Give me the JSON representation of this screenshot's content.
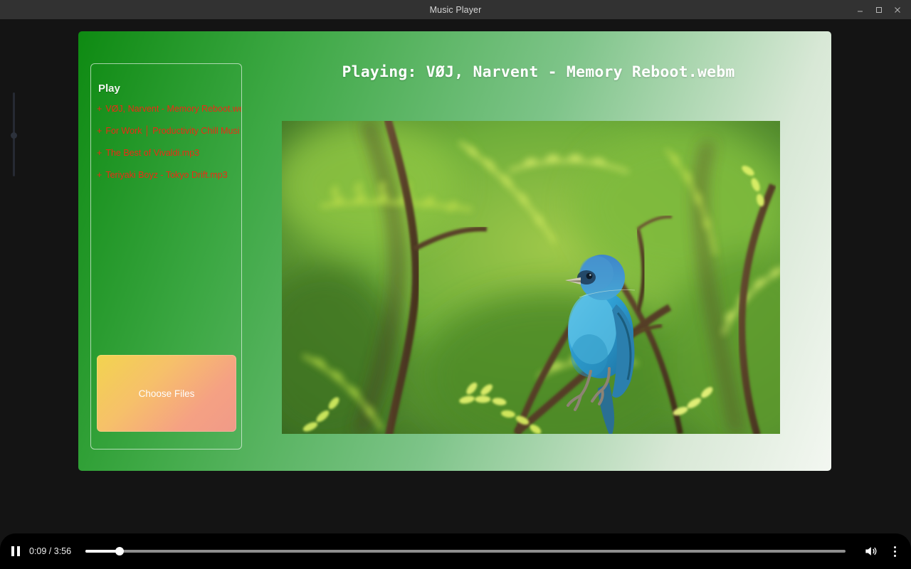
{
  "window": {
    "title": "Music Player",
    "controls": [
      {
        "name": "minimize-button",
        "glyph": "–"
      },
      {
        "name": "maximize-button",
        "glyph": "□"
      },
      {
        "name": "close-button",
        "glyph": "×"
      }
    ]
  },
  "sidebar": {
    "heading": "Play",
    "playlist": [
      {
        "bullet": "+",
        "label": "VØJ, Narvent - Memory Reboot.we"
      },
      {
        "bullet": "+",
        "label": "For Work │ Productivity Chill Musi"
      },
      {
        "bullet": "+",
        "label": "The Best of Vivaldi.mp3"
      },
      {
        "bullet": "+",
        "label": "Teriyaki Boyz - Tokyo Drift.mp3"
      }
    ],
    "choose_files_label": "Choose Files"
  },
  "main": {
    "now_playing": "Playing: VØJ, Narvent - Memory Reboot.webm",
    "video_alt": "indigo-bunting-perched-on-branch"
  },
  "player": {
    "pause_icon": "pause-icon",
    "current_time": "0:09",
    "duration": "3:56",
    "time_display": "0:09 / 3:56",
    "progress_percent": 4.5,
    "volume_icon": "volume-icon",
    "menu_icon": "more-vertical-icon"
  },
  "colors": {
    "titlebar": "#323232",
    "page_gradient_start": "#0e8a12",
    "page_gradient_end": "#f3f7f1",
    "playlist_text": "#ee2a14",
    "choose_files_gradient_start": "#f2d44f",
    "choose_files_gradient_end": "#f09a88",
    "mediabar": "#000000"
  }
}
